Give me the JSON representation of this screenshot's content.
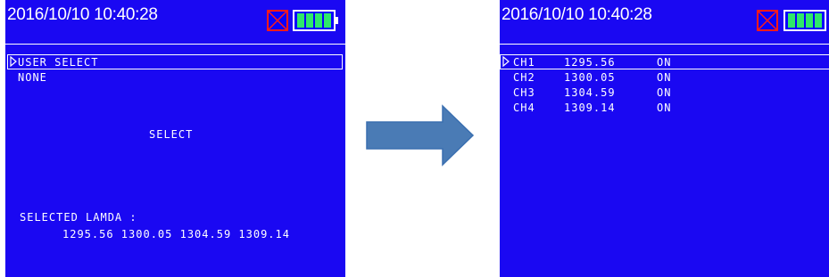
{
  "left_screen": {
    "datetime": "2016/10/10  10:40:28",
    "menu_items": [
      "USER SELECT",
      "NONE"
    ],
    "center_label": "SELECT",
    "selected_label": "SELECTED LAMDA :",
    "selected_values": "1295.56 1300.05 1304.59  1309.14"
  },
  "right_screen": {
    "datetime": "2016/10/10  10:40:28",
    "channels": [
      {
        "name": "CH1",
        "value": "1295.56",
        "state": "ON"
      },
      {
        "name": "CH2",
        "value": "1300.05",
        "state": "ON"
      },
      {
        "name": "CH3",
        "value": "1304.59",
        "state": "ON"
      },
      {
        "name": "CH4",
        "value": "1309.14",
        "state": "ON"
      }
    ]
  },
  "icons": [
    "no-signal-icon",
    "battery-icon",
    "caret-icon",
    "arrow-right-icon"
  ],
  "colors": {
    "screen_bg": "#1a08f2",
    "text": "#ffffff",
    "battery_fill": "#2ee86a",
    "alert_icon": "#ff1a1a",
    "arrow_fill": "#4a7bb5",
    "arrow_stroke": "#3a6fb0"
  }
}
